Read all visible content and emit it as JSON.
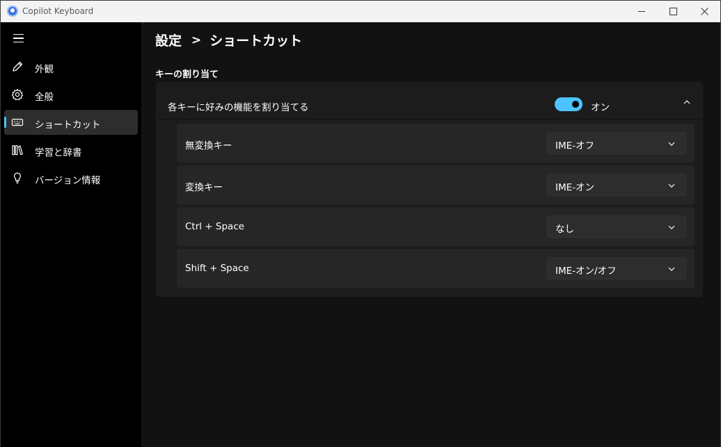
{
  "window": {
    "title": "Copilot Keyboard"
  },
  "sidebar": {
    "items": [
      {
        "label": "外観",
        "icon": "pencil-icon"
      },
      {
        "label": "全般",
        "icon": "gear-icon"
      },
      {
        "label": "ショートカット",
        "icon": "keyboard-icon",
        "selected": true
      },
      {
        "label": "学習と辞書",
        "icon": "library-icon"
      },
      {
        "label": "バージョン情報",
        "icon": "lightbulb-icon"
      }
    ]
  },
  "breadcrumb": {
    "parent": "設定",
    "separator": ">",
    "current": "ショートカット"
  },
  "section": {
    "title": "キーの割り当て"
  },
  "expander": {
    "label": "各キーに好みの機能を割り当てる",
    "toggle_on": true,
    "toggle_state_label": "オン"
  },
  "assignments": [
    {
      "key": "無変換キー",
      "value": "IME-オフ"
    },
    {
      "key": "変換キー",
      "value": "IME-オン"
    },
    {
      "key": "Ctrl + Space",
      "value": "なし"
    },
    {
      "key": "Shift + Space",
      "value": "IME-オン/オフ"
    }
  ],
  "colors": {
    "accent": "#4cc2ff",
    "background": "#121212",
    "sidebar": "#000000",
    "card": "#1c1c1c",
    "row": "#262626"
  }
}
